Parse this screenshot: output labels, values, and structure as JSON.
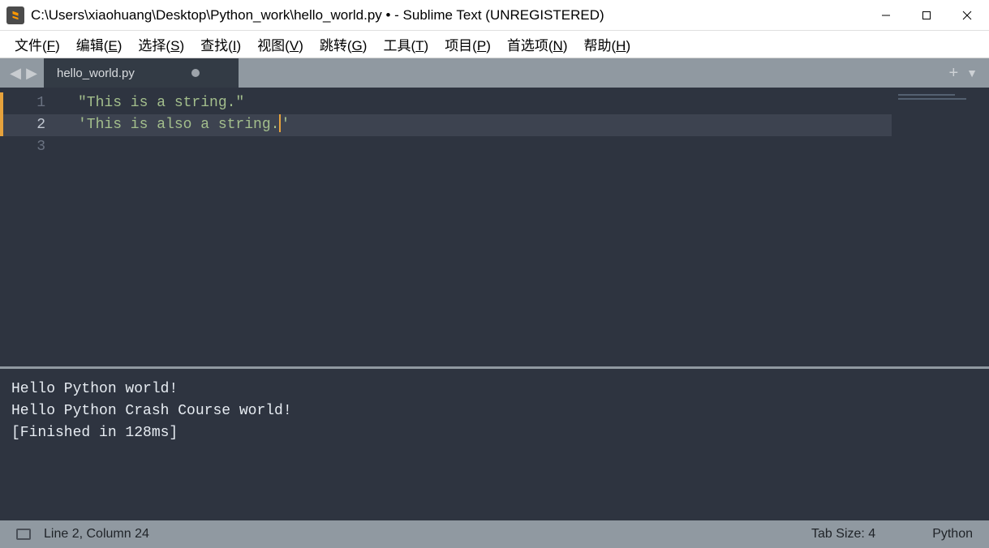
{
  "window": {
    "title": "C:\\Users\\xiaohuang\\Desktop\\Python_work\\hello_world.py • - Sublime Text (UNREGISTERED)"
  },
  "menu": {
    "file": {
      "label": "文件(",
      "key": "F",
      "suffix": ")"
    },
    "edit": {
      "label": "编辑(",
      "key": "E",
      "suffix": ")"
    },
    "select": {
      "label": "选择(",
      "key": "S",
      "suffix": ")"
    },
    "find": {
      "label": "查找(",
      "key": "I",
      "suffix": ")"
    },
    "view": {
      "label": "视图(",
      "key": "V",
      "suffix": ")"
    },
    "goto": {
      "label": "跳转(",
      "key": "G",
      "suffix": ")"
    },
    "tools": {
      "label": "工具(",
      "key": "T",
      "suffix": ")"
    },
    "project": {
      "label": "项目(",
      "key": "P",
      "suffix": ")"
    },
    "prefs": {
      "label": "首选项(",
      "key": "N",
      "suffix": ")"
    },
    "help": {
      "label": "帮助(",
      "key": "H",
      "suffix": ")"
    }
  },
  "tabs": {
    "active": {
      "label": "hello_world.py"
    }
  },
  "editor": {
    "lines": {
      "l1": {
        "num": "1",
        "text": "\"This is a string.\""
      },
      "l2": {
        "num": "2",
        "text_pre": "'This is also a string.",
        "text_post": "'"
      },
      "l3": {
        "num": "3",
        "text": ""
      }
    }
  },
  "output": {
    "line1": "Hello Python world!",
    "line2": "Hello Python Crash Course world!",
    "line3": "[Finished in 128ms]"
  },
  "status": {
    "position": "Line 2, Column 24",
    "tab_size": "Tab Size: 4",
    "syntax": "Python"
  }
}
